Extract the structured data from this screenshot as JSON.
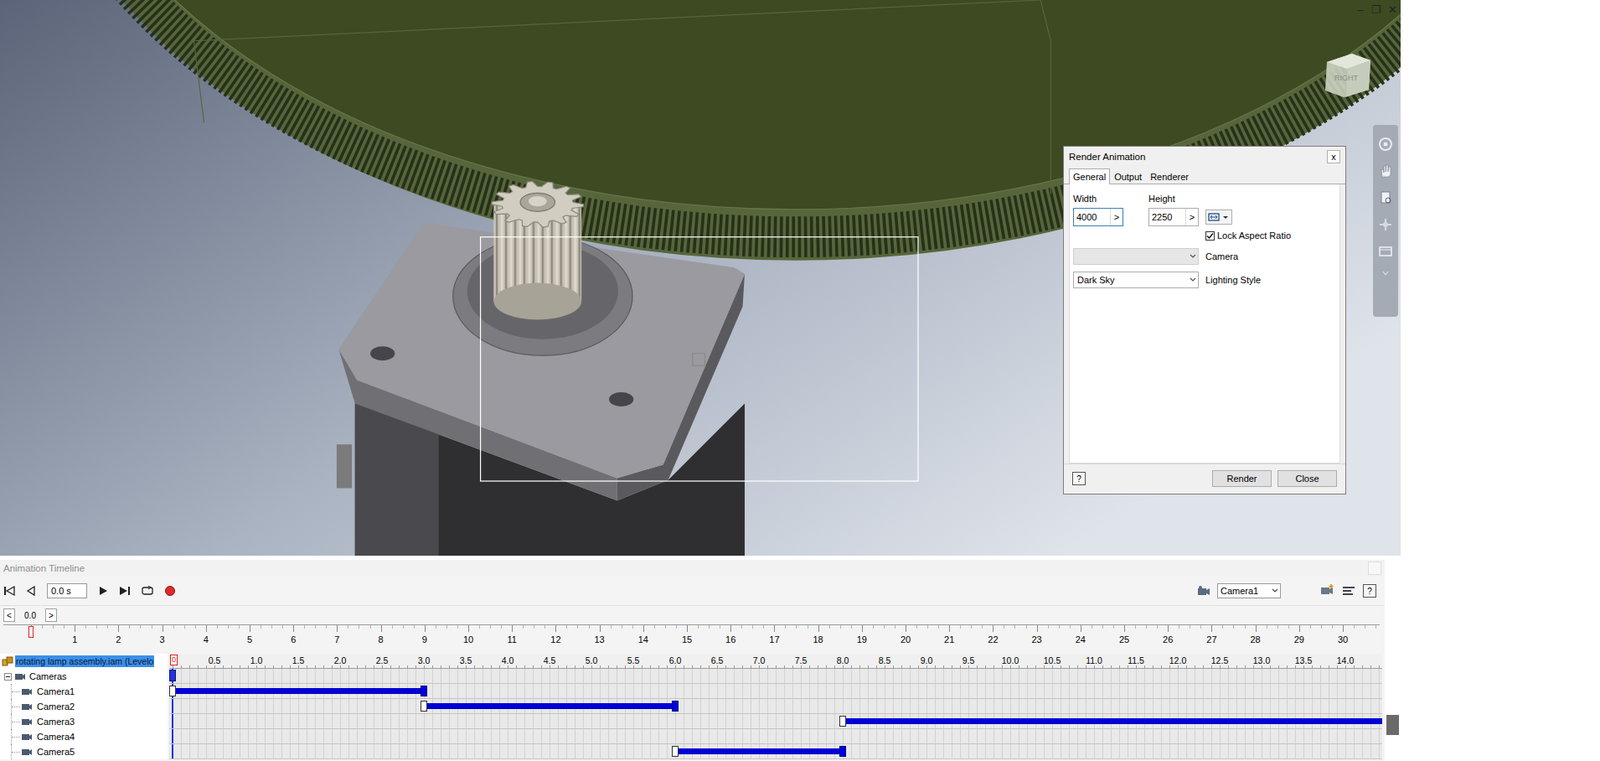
{
  "window_controls": [
    "–",
    "❐",
    "✕"
  ],
  "viewcube": {
    "label": "RIGHT"
  },
  "dialog": {
    "title": "Render Animation",
    "close": "x",
    "tabs": [
      {
        "label": "General",
        "selected": true
      },
      {
        "label": "Output",
        "selected": false
      },
      {
        "label": "Renderer",
        "selected": false
      }
    ],
    "width": {
      "label": "Width",
      "value": "4000",
      "button": ">",
      "focused": true
    },
    "height": {
      "label": "Height",
      "value": "2250",
      "button": ">",
      "focused": false
    },
    "lock_aspect_ratio": {
      "label": "Lock Aspect Ratio",
      "checked": true
    },
    "camera": {
      "label": "Camera",
      "value": "",
      "disabled": true
    },
    "lighting_style": {
      "label": "Lighting Style",
      "value": "Dark Sky",
      "disabled": false
    },
    "help": "?",
    "buttons": [
      "Render",
      "Close"
    ]
  },
  "timeline": {
    "title": "Animation Timeline",
    "time_field": "0.0 s",
    "camera_select": "Camera1",
    "help": "?",
    "scrub": {
      "prev": "<",
      "value": "0.0",
      "next": ">"
    },
    "frame_ruler": {
      "labels": [
        "1",
        "2",
        "3",
        "4",
        "5",
        "6",
        "7",
        "8",
        "9",
        "10",
        "11",
        "12",
        "13",
        "14",
        "15",
        "16",
        "17",
        "18",
        "19",
        "20",
        "21",
        "22",
        "23",
        "24",
        "25",
        "26",
        "27",
        "28",
        "29",
        "30"
      ],
      "playhead": 0
    },
    "seconds_ruler": {
      "playhead_label": "0",
      "labels": [
        "0.5",
        "1.0",
        "1.5",
        "2.0",
        "2.5",
        "3.0",
        "3.5",
        "4.0",
        "4.5",
        "5.0",
        "5.5",
        "6.0",
        "6.5",
        "7.0",
        "7.5",
        "8.0",
        "8.5",
        "9.0",
        "9.5",
        "10.0",
        "10.5",
        "11.0",
        "11.5",
        "12.0",
        "12.5",
        "13.0",
        "13.5",
        "14.0"
      ]
    },
    "tree": [
      {
        "label": "rotating lamp assembly.iam (Levelo",
        "kind": "root",
        "selected": true
      },
      {
        "label": "Cameras",
        "kind": "folder",
        "selected": false,
        "expanded": true
      },
      {
        "label": "Camera1",
        "kind": "camera",
        "selected": false,
        "segments": [
          {
            "start": 0,
            "end": 3.0,
            "end_key": true
          }
        ]
      },
      {
        "label": "Camera2",
        "kind": "camera",
        "selected": false,
        "segments": [
          {
            "start": 3.0,
            "end": 6.0,
            "end_key": true
          }
        ]
      },
      {
        "label": "Camera3",
        "kind": "camera",
        "selected": false,
        "segments": [
          {
            "start": 8.0,
            "end": 14.5,
            "end_key": false
          }
        ]
      },
      {
        "label": "Camera4",
        "kind": "camera",
        "selected": false,
        "segments": []
      },
      {
        "label": "Camera5",
        "kind": "camera",
        "selected": false,
        "segments": [
          {
            "start": 6.0,
            "end": 8.0,
            "end_key": true
          }
        ]
      }
    ]
  }
}
